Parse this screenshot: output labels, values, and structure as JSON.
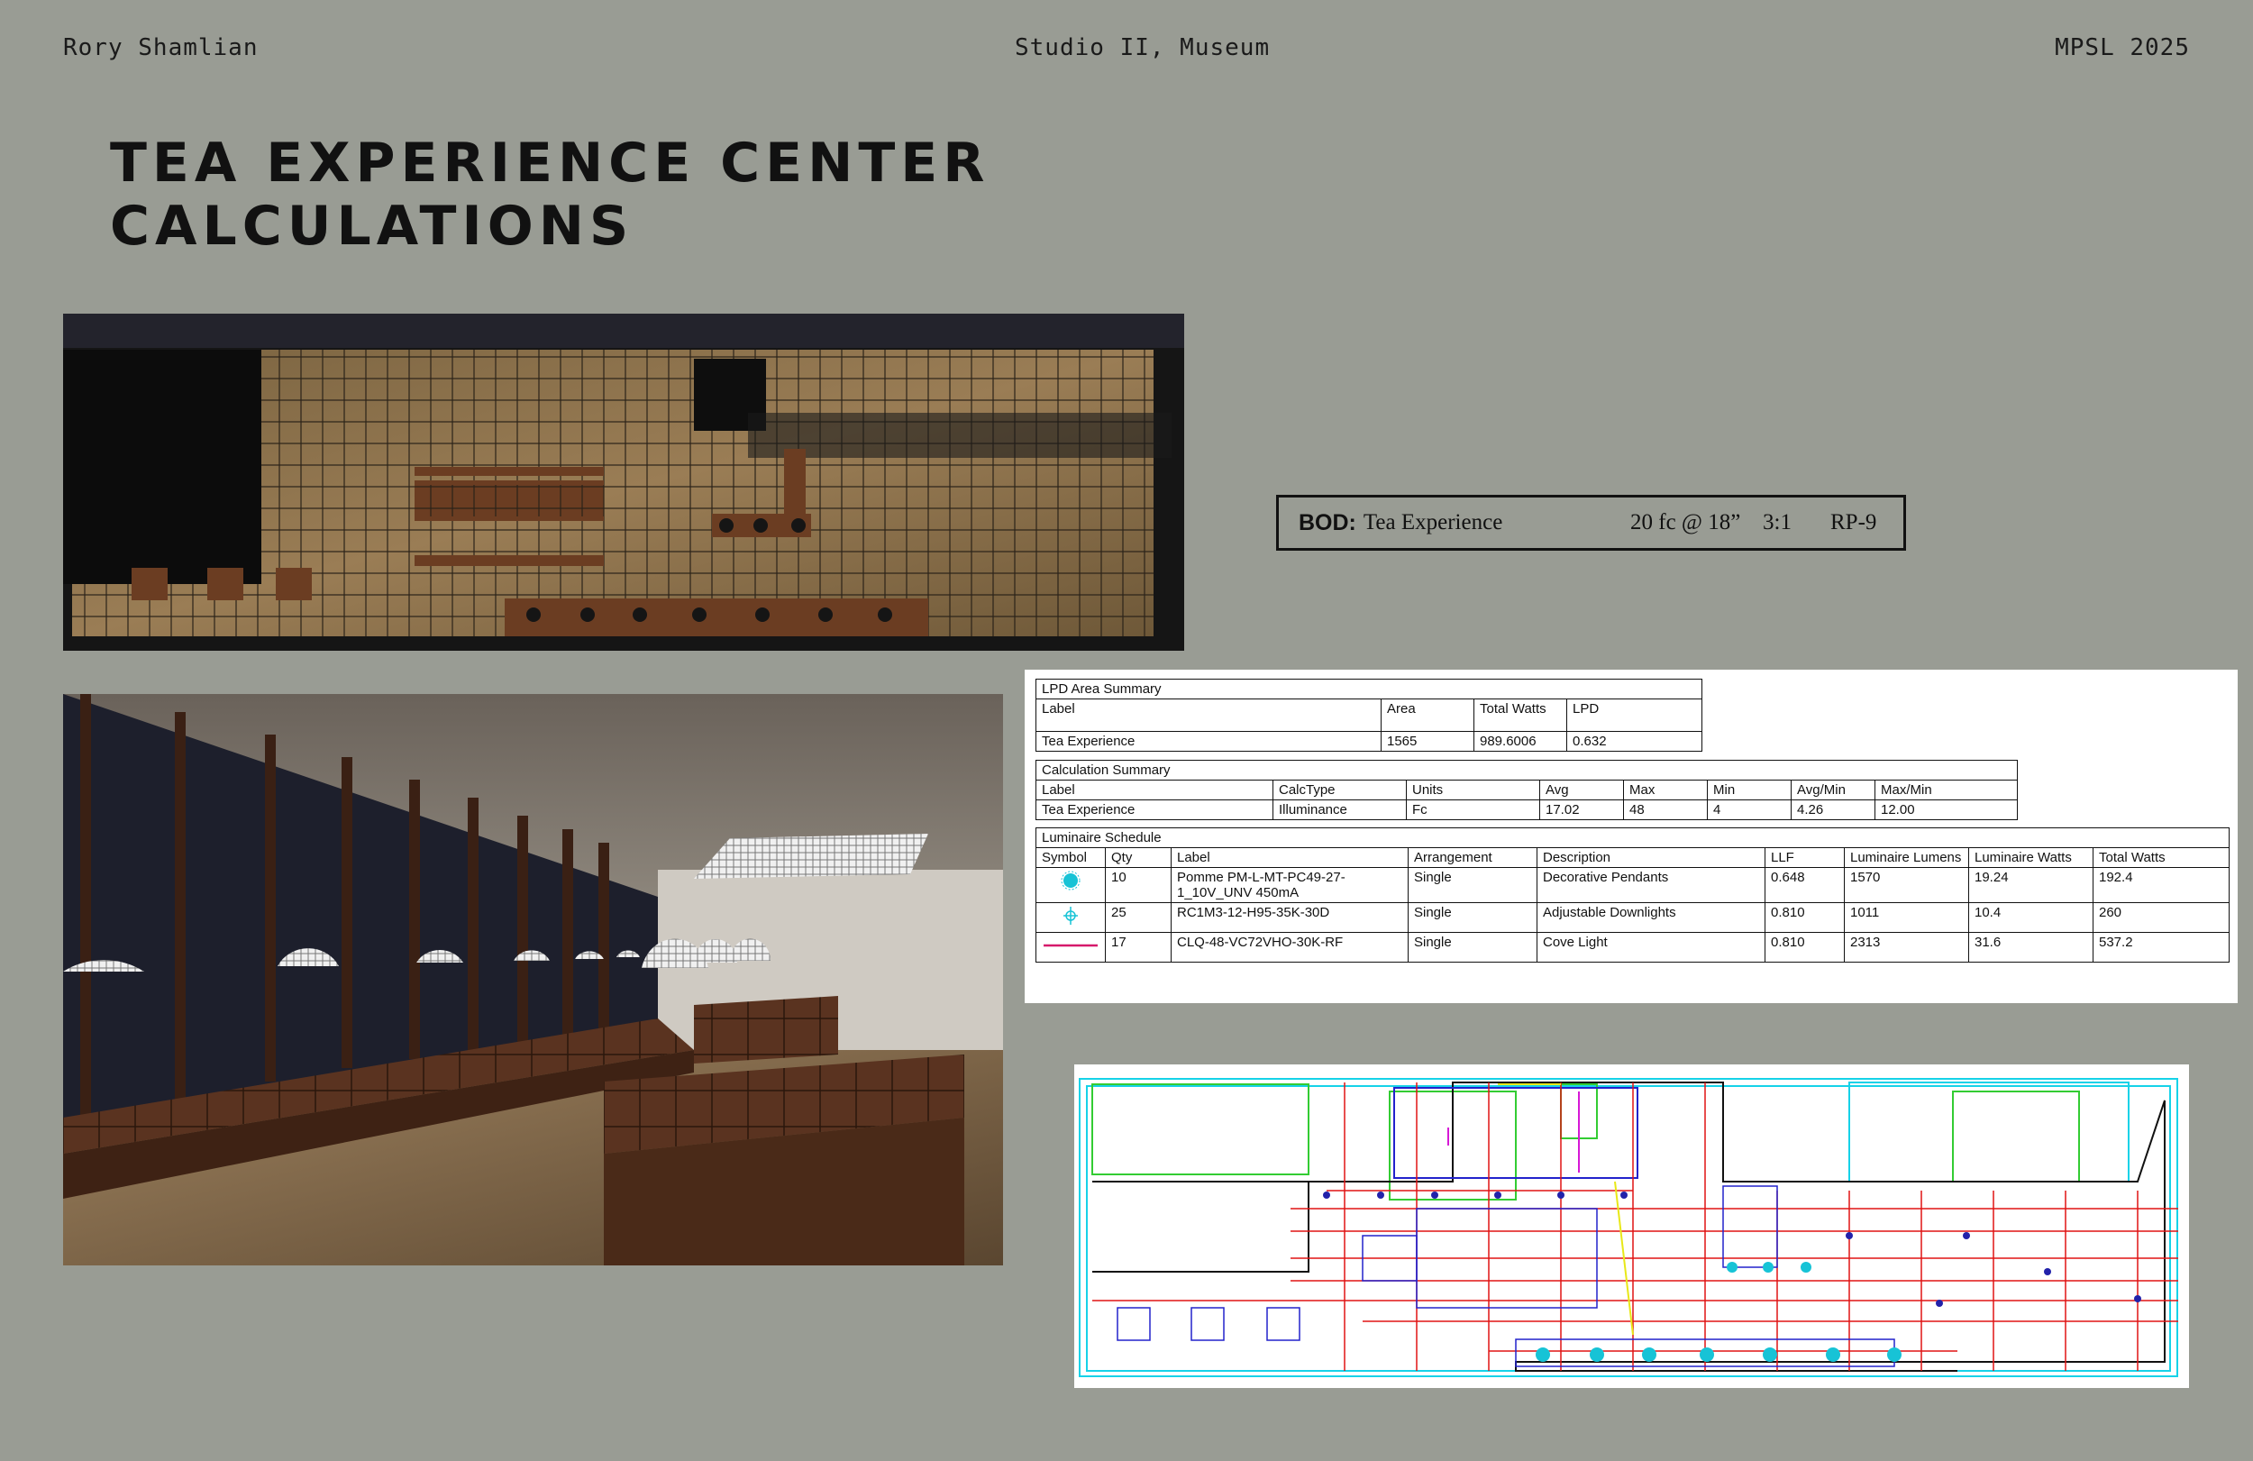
{
  "header": {
    "author": "Rory Shamlian",
    "course": "Studio II, Museum",
    "program": "MPSL 2025"
  },
  "title": {
    "line1": "TEA EXPERIENCE CENTER",
    "line2": "CALCULATIONS"
  },
  "bod": {
    "key": "BOD:",
    "value": "Tea Experience",
    "target": "20 fc @ 18”",
    "ratio": "3:1",
    "ref": "RP-9"
  },
  "lpd": {
    "caption": "LPD Area Summary",
    "headers": [
      "Label",
      "Area",
      "Total Watts",
      "LPD"
    ],
    "rows": [
      [
        "Tea Experience",
        "1565",
        "989.6006",
        "0.632"
      ]
    ]
  },
  "calc": {
    "caption": "Calculation Summary",
    "headers": [
      "Label",
      "CalcType",
      "Units",
      "Avg",
      "Max",
      "Min",
      "Avg/Min",
      "Max/Min"
    ],
    "rows": [
      [
        "Tea Experience",
        "Illuminance",
        "Fc",
        "17.02",
        "48",
        "4",
        "4.26",
        "12.00"
      ]
    ]
  },
  "schedule": {
    "caption": "Luminaire Schedule",
    "headers": [
      "Symbol",
      "Qty",
      "Label",
      "Arrangement",
      "Description",
      "LLF",
      "Luminaire Lumens",
      "Luminaire Watts",
      "Total Watts"
    ],
    "rows": [
      {
        "symbol": "pendant-symbol-icon",
        "qty": "10",
        "label": "Pomme PM-L-MT-PC49-27-1_10V_UNV 450mA",
        "arrangement": "Single",
        "description": "Decorative Pendants",
        "llf": "0.648",
        "lumens": "1570",
        "watts": "19.24",
        "total": "192.4"
      },
      {
        "symbol": "downlight-symbol-icon",
        "qty": "25",
        "label": "RC1M3-12-H95-35K-30D",
        "arrangement": "Single",
        "description": "Adjustable Downlights",
        "llf": "0.810",
        "lumens": "1011",
        "watts": "10.4",
        "total": "260"
      },
      {
        "symbol": "cove-line-symbol-icon",
        "qty": "17",
        "label": "CLQ-48-VC72VHO-30K-RF",
        "arrangement": "Single",
        "description": "Cove Light",
        "llf": "0.810",
        "lumens": "2313",
        "watts": "31.6",
        "total": "537.2"
      }
    ]
  },
  "colors": {
    "background": "#999c94",
    "pendant": "#17c3d6",
    "cove": "#d6196b",
    "grid_red": "#e01414"
  }
}
